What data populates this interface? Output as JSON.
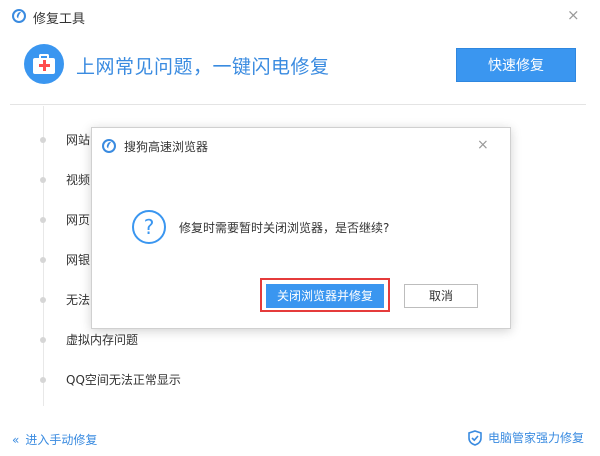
{
  "app": {
    "title": "修复工具",
    "close": "×"
  },
  "header": {
    "headline": "上网常见问题，一键闪电修复",
    "quick_fix": "快速修复"
  },
  "issues": [
    {
      "label": "网站"
    },
    {
      "label": "视频"
    },
    {
      "label": "网页"
    },
    {
      "label": "网银"
    },
    {
      "label": "无法"
    },
    {
      "label": "虚拟内存问题"
    },
    {
      "label": "QQ空间无法正常显示"
    }
  ],
  "footer": {
    "manual_repair": "进入手动修复",
    "manual_chevron": "«",
    "pc_manager": "电脑管家强力修复"
  },
  "dialog": {
    "title": "搜狗高速浏览器",
    "close": "×",
    "question_mark": "?",
    "message": "修复时需要暂时关闭浏览器，是否继续?",
    "confirm": "关闭浏览器并修复",
    "cancel": "取消"
  },
  "colors": {
    "accent": "#3a96f0",
    "highlight": "#e53b3b"
  },
  "icons": {
    "header": "first-aid-kit-icon",
    "dialog": "question-icon",
    "footer": "shield-icon"
  }
}
